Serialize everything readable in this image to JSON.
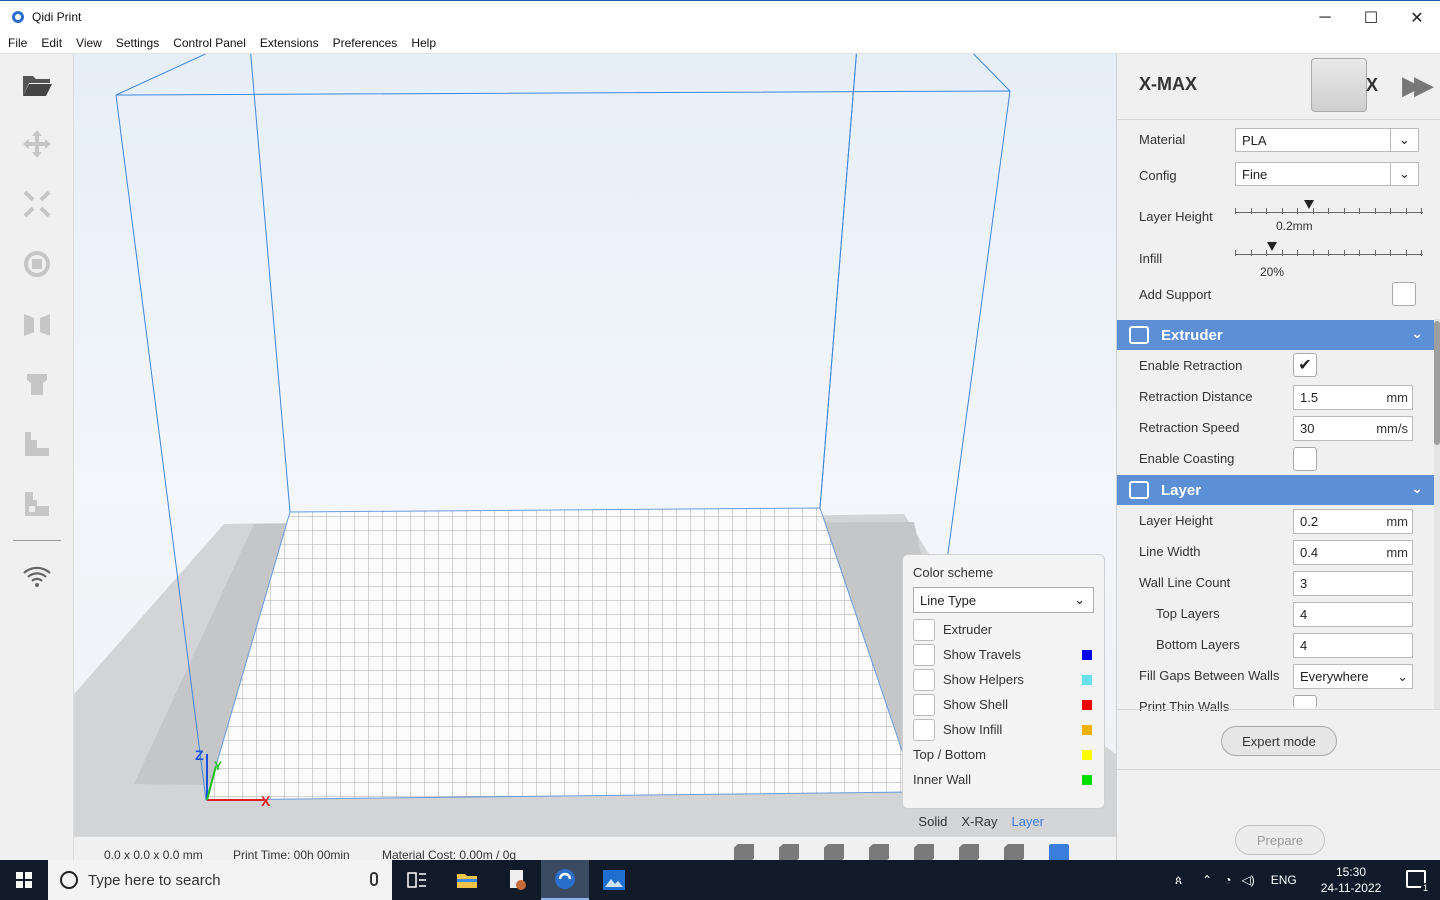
{
  "window": {
    "title": "Qidi Print",
    "minimize": "─",
    "maximize": "☐",
    "close": "✕"
  },
  "menu": [
    "File",
    "Edit",
    "View",
    "Settings",
    "Control Panel",
    "Extensions",
    "Preferences",
    "Help"
  ],
  "left_tools": [
    "open-folder-icon",
    "move-icon",
    "scale-icon",
    "rotate-icon",
    "mirror-icon",
    "support-icon",
    "layer-view-icon",
    "layer-view-2-icon",
    "wifi-icon"
  ],
  "color_scheme": {
    "title": "Color scheme",
    "selected": "Line Type",
    "items": [
      {
        "label": "Extruder",
        "checkbox": true,
        "color": ""
      },
      {
        "label": "Show Travels",
        "checkbox": true,
        "color": "#0000ee"
      },
      {
        "label": "Show Helpers",
        "checkbox": true,
        "color": "#66e0e8"
      },
      {
        "label": "Show Shell",
        "checkbox": true,
        "color": "#ee0000"
      },
      {
        "label": "Show Infill",
        "checkbox": true,
        "color": "#f0b000"
      },
      {
        "label": "Top / Bottom",
        "checkbox": false,
        "color": "#ffff00"
      },
      {
        "label": "Inner Wall",
        "checkbox": false,
        "color": "#00dd00"
      }
    ]
  },
  "view_modes": {
    "solid": "Solid",
    "xray": "X-Ray",
    "layer": "Layer",
    "active": "Layer"
  },
  "status": {
    "dimensions": "0.0 x 0.0 x 0.0 mm",
    "print_time": "Print Time: 00h 00min",
    "material_cost": "Material Cost: 0.00m / 0g"
  },
  "right_panel": {
    "printer": "X-MAX",
    "material_label": "Material",
    "material_value": "PLA",
    "config_label": "Config",
    "config_value": "Fine",
    "layer_height_label": "Layer Height",
    "layer_height_value": "0.2mm",
    "layer_height_fraction": 0.4,
    "infill_label": "Infill",
    "infill_value": "20%",
    "infill_fraction": 0.2,
    "add_support_label": "Add Support",
    "extruder": {
      "title": "Extruder",
      "enable_retraction_label": "Enable Retraction",
      "enable_retraction_checked": true,
      "retraction_distance_label": "Retraction Distance",
      "retraction_distance_value": "1.5",
      "retraction_distance_unit": "mm",
      "retraction_speed_label": "Retraction Speed",
      "retraction_speed_value": "30",
      "retraction_speed_unit": "mm/s",
      "enable_coasting_label": "Enable Coasting"
    },
    "layer": {
      "title": "Layer",
      "layer_height_label": "Layer Height",
      "layer_height_value": "0.2",
      "layer_height_unit": "mm",
      "line_width_label": "Line Width",
      "line_width_value": "0.4",
      "line_width_unit": "mm",
      "wall_line_count_label": "Wall Line Count",
      "wall_line_count_value": "3",
      "top_layers_label": "Top Layers",
      "top_layers_value": "4",
      "bottom_layers_label": "Bottom Layers",
      "bottom_layers_value": "4",
      "fill_gaps_label": "Fill Gaps Between Walls",
      "fill_gaps_value": "Everywhere",
      "print_thin_walls_label": "Print Thin Walls"
    },
    "expert_mode": "Expert mode",
    "prepare": "Prepare"
  },
  "taskbar": {
    "search_placeholder": "Type here to search",
    "lang": "ENG",
    "time": "15:30",
    "date": "24-11-2022",
    "notifications": "1"
  },
  "axes": {
    "x": "X",
    "y": "Y",
    "z": "Z"
  }
}
